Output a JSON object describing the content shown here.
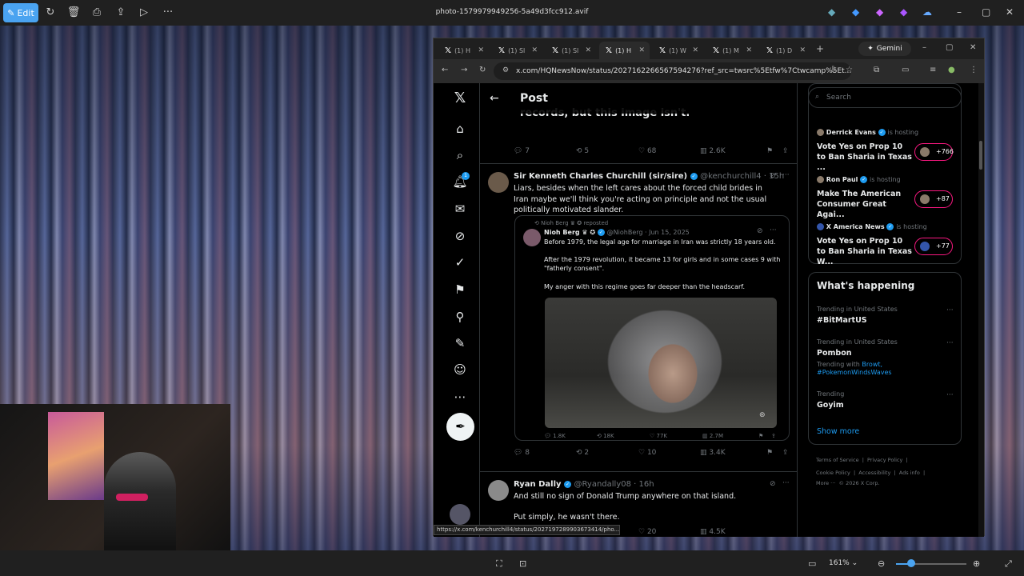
{
  "viewer": {
    "edit_label": "Edit",
    "file_title": "photo-1579979949256-5a49d3fcc912.avif",
    "zoom": "161%"
  },
  "browser": {
    "tabs": [
      {
        "label": "(1) H"
      },
      {
        "label": "(1) Sl"
      },
      {
        "label": "(1) Sl"
      },
      {
        "label": "(1) H"
      },
      {
        "label": "(1) W"
      },
      {
        "label": "(1) M"
      },
      {
        "label": "(1) D"
      }
    ],
    "gemini_label": "Gemini",
    "url": "x.com/HQNewsNow/status/2027162266567594276?ref_src=twsrc%5Etfw%7Ctwcamp%5Et...",
    "status_url": "https://x.com/kenchurchill4/status/2027197289903673414/pho..."
  },
  "x": {
    "header_title": "Post",
    "prev_text": "records, but this image isn't.",
    "prev_actions": {
      "replies": "7",
      "reposts": "5",
      "likes": "68",
      "views": "2.6K"
    },
    "tweet1": {
      "name": "Sir Kenneth Charles Churchill (sir/sire)",
      "handle": "@kenchurchill4 · 15h",
      "text": "Liars, besides when the left cares about the forced child brides in Iran maybe we'll think you're acting on principle and not the usual politically motivated slander.",
      "quote": {
        "reposted": "Nioh Berg ♛ ✪ reposted",
        "name": "Nioh Berg ♛ ✪",
        "handle": "@NiohBerg · Jun 15, 2025",
        "line1": "Before 1979, the legal age for marriage in Iran was strictly 18 years old.",
        "line2": "After the 1979 revolution, it became 13 for girls and in some cases 9 with \"fatherly consent\".",
        "line3": "My anger with this regime goes far deeper than the headscarf.",
        "actions": {
          "replies": "1.8K",
          "reposts": "18K",
          "likes": "77K",
          "views": "2.7M"
        }
      },
      "actions": {
        "replies": "8",
        "reposts": "2",
        "likes": "10",
        "views": "3.4K"
      }
    },
    "tweet2": {
      "name": "Ryan Dally",
      "handle": "@Ryandally08 · 16h",
      "line1": "And still no sign of Donald Trump anywhere on that island.",
      "line2": "Put simply, he wasn't there.",
      "actions": {
        "likes": "20",
        "views": "4.5K"
      }
    },
    "search_placeholder": "Search",
    "spaces": [
      {
        "host": "Derrick Evans",
        "hosting": "is hosting",
        "title": "Vote Yes on Prop 10 to Ban Sharia in Texas ...",
        "count": "+766"
      },
      {
        "host": "Ron Paul",
        "hosting": "is hosting",
        "title": "Make The American Consumer Great Agai...",
        "count": "+87"
      },
      {
        "host": "X America News",
        "hosting": "is hosting",
        "title": "Vote Yes on Prop 10 to Ban Sharia in Texas W...",
        "count": "+77"
      }
    ],
    "whats_happening": "What's happening",
    "trends": [
      {
        "context": "Trending in United States",
        "name": "#BitMartUS"
      },
      {
        "context": "Trending in United States",
        "name": "Pombon",
        "with_label": "Trending with",
        "with1": "Browt,",
        "with2": "#PokemonWindsWaves"
      },
      {
        "context": "Trending",
        "name": "Goyim"
      }
    ],
    "show_more": "Show more",
    "footer": {
      "terms": "Terms of Service",
      "privacy": "Privacy Policy",
      "cookie": "Cookie Policy",
      "accessibility": "Accessibility",
      "ads": "Ads info",
      "more": "More ···",
      "copyright": "© 2026 X Corp."
    },
    "notif_count": "1"
  },
  "colors": {
    "accent": "#1d9bf0",
    "pink": "#f91880",
    "viewer_edit": "#4aa3f0"
  }
}
